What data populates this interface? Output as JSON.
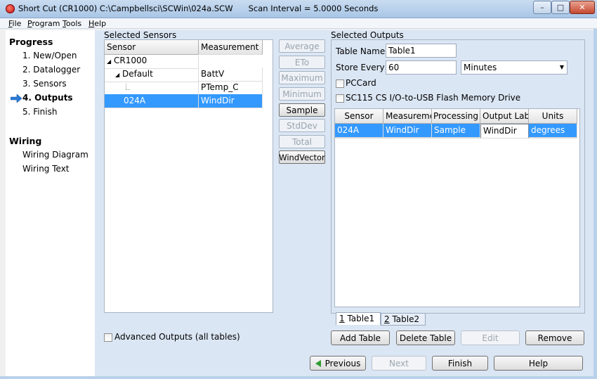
{
  "window": {
    "title": "Short Cut (CR1000) C:\\Campbellsci\\SCWin\\024a.SCW",
    "scan_interval": "Scan Interval = 5.0000 Seconds",
    "controls": {
      "minimize": "–",
      "maximize": "□",
      "close": "✕"
    }
  },
  "menu": [
    {
      "key": "F",
      "rest": "ile"
    },
    {
      "key": "P",
      "rest": "rogram"
    },
    {
      "key": "T",
      "rest": "ools"
    },
    {
      "key": "H",
      "rest": "elp"
    }
  ],
  "progress": {
    "heading": "Progress",
    "steps": [
      "1. New/Open",
      "2. Datalogger",
      "3. Sensors",
      "4. Outputs",
      "5. Finish"
    ],
    "current_icon": "right-arrow-icon"
  },
  "wiring": {
    "heading": "Wiring",
    "items": [
      "Wiring Diagram",
      "Wiring Text"
    ]
  },
  "selected_sensors": {
    "label": "Selected Sensors",
    "columns": [
      "Sensor",
      "Measurement"
    ],
    "rows": [
      {
        "sensor": "CR1000",
        "measurement": ""
      },
      {
        "sensor": "Default",
        "measurement": "BattV"
      },
      {
        "sensor": "",
        "measurement": "PTemp_C"
      },
      {
        "sensor": "024A",
        "measurement": "WindDir"
      }
    ]
  },
  "functions": [
    "Average",
    "ETo",
    "Maximum",
    "Minimum",
    "Sample",
    "StdDev",
    "Total",
    "WindVector"
  ],
  "advanced_outputs": "Advanced Outputs (all tables)",
  "selected_outputs": {
    "label": "Selected Outputs",
    "table_name_label": "Table Name",
    "table_name_value": "Table1",
    "store_every_label": "Store Every",
    "store_every_value": "60",
    "interval_unit": "Minutes",
    "pccard_label": "PCCard",
    "sc115_label": "SC115 CS I/O-to-USB Flash Memory Drive",
    "columns": [
      "Sensor",
      "Measuremen",
      "Processing",
      "Output Labe",
      "Units"
    ],
    "rows": [
      {
        "sensor": "024A",
        "measurement": "WindDir",
        "processing": "Sample",
        "output_label": "WindDir",
        "units": "degrees"
      }
    ],
    "tabs": [
      {
        "key": "1",
        "rest": " Table1"
      },
      {
        "key": "2",
        "rest": " Table2"
      }
    ]
  },
  "table_buttons": {
    "add": "Add Table",
    "delete": "Delete Table",
    "edit": "Edit",
    "remove": "Remove"
  },
  "nav": {
    "previous": "Previous",
    "next": "Next",
    "finish": "Finish",
    "help": "Help"
  },
  "colors": {
    "selection": "#3399ff",
    "arrow": "#2b7bd6",
    "previous_arrow": "#2e9a2e"
  }
}
